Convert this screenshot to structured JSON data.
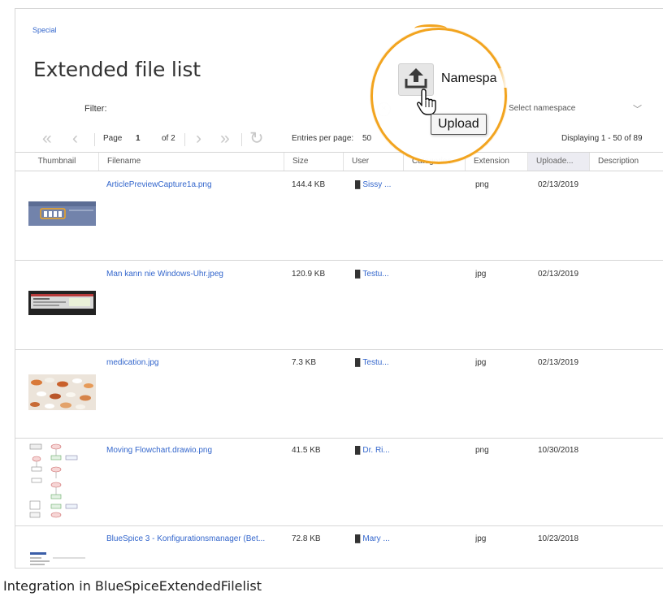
{
  "breadcrumb": "Special",
  "page_title": "Extended file list",
  "filter": {
    "label": "Filter:",
    "clear_glyph": "×",
    "namespace_placeholder": "Select namespace",
    "chevron_glyph": "﹀"
  },
  "pager": {
    "first_glyph": "«",
    "prev_glyph": "‹",
    "page_label": "Page",
    "current_page": "1",
    "of_label": "of 2",
    "next_glyph": "›",
    "last_glyph": "»",
    "refresh_glyph": "↻",
    "entries_label": "Entries per page:",
    "entries_value": "50",
    "displaying": "Displaying 1 - 50 of 89"
  },
  "columns": {
    "thumbnail": "Thumbnail",
    "filename": "Filename",
    "size": "Size",
    "user": "User",
    "categories": "Categories",
    "extension": "Extension",
    "uploaded": "Uploade...",
    "description": "Description"
  },
  "rows": [
    {
      "filename": "ArticlePreviewCapture1a.png",
      "size": "144.4 KB",
      "user": "Sissy ...",
      "categories": "",
      "extension": "png",
      "date": "02/13/2019",
      "thumb": "screenshot-thumbnail-icon"
    },
    {
      "filename": "Man kann nie Windows-Uhr.jpeg",
      "size": "120.9 KB",
      "user": "Testu...",
      "categories": "",
      "extension": "jpg",
      "date": "02/13/2019",
      "thumb": "dark-screenshot-thumbnail-icon"
    },
    {
      "filename": "medication.jpg",
      "size": "7.3 KB",
      "user": "Testu...",
      "categories": "",
      "extension": "jpg",
      "date": "02/13/2019",
      "thumb": "pills-photo-thumbnail-icon"
    },
    {
      "filename": "Moving Flowchart.drawio.png",
      "size": "41.5 KB",
      "user": "Dr. Ri...",
      "categories": "",
      "extension": "png",
      "date": "10/30/2018",
      "thumb": "flowchart-thumbnail-icon"
    },
    {
      "filename": "BlueSpice 3 - Konfigurationsmanager (Bet...",
      "size": "72.8 KB",
      "user": "Mary ...",
      "categories": "",
      "extension": "jpg",
      "date": "10/23/2018",
      "thumb": "config-screenshot-thumbnail-icon"
    }
  ],
  "callout": {
    "namespace_text": "Namespa",
    "tooltip": "Upload",
    "upload_icon": "upload-icon",
    "cursor_icon": "hand-pointer-icon",
    "ring_color": "#f2a41f"
  },
  "caption": "Integration in BlueSpiceExtendedFilelist",
  "colors": {
    "link": "#3366cc",
    "sorted_header": "#ececf2",
    "border": "#d6d6d6"
  }
}
